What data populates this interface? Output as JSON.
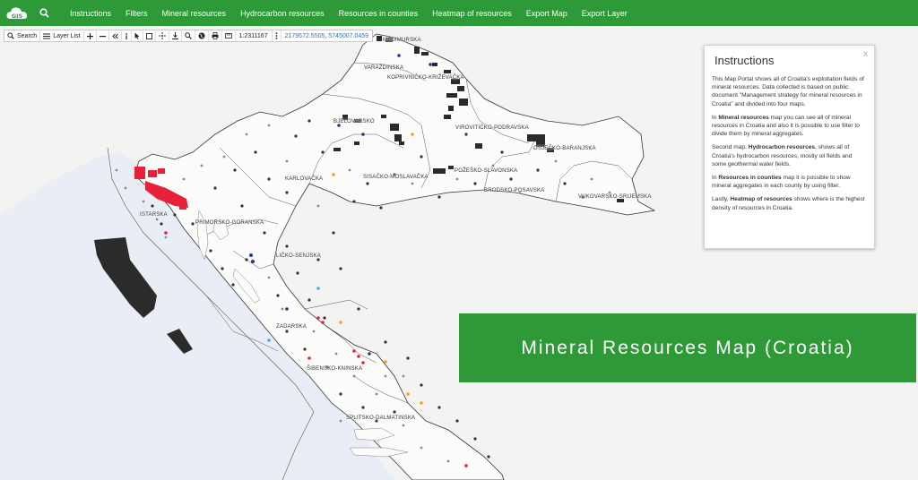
{
  "navbar": {
    "logo_text": "GIS",
    "items": [
      "Instructions",
      "Filters",
      "Mineral resources",
      "Hydrocarbon resources",
      "Resources in counties",
      "Heatmap of resources",
      "Export Map",
      "Export Layer"
    ]
  },
  "toolbar": {
    "search_label": "Search",
    "layer_list_label": "Layer List",
    "scale": "1:2311167",
    "coordinates": "2179572.5505, 5745007.0459"
  },
  "counties": {
    "medimurska": "MEĐIMURSKA",
    "varazdinska": "VARAŽDINSKA",
    "koprivnicko": "KOPRIVNIČKO-KRIŽEVAČKA",
    "bjelovarsko": "BJELOVARSKO",
    "viroviticko": "VIROVITIČKO-PODRAVSKA",
    "osjecko": "OSJEČKO-BARANJSKA",
    "pozesko": "POŽEŠKO-SLAVONSKA",
    "karlovacka": "KARLOVAČKA",
    "sisacko": "SISAČKO-MOSLAVAČKA",
    "brodsko": "BRODSKO-POSAVSKA",
    "vukovarsko": "VUKOVARSKO-SRIJEMSKA",
    "istarska": "ISTARSKA",
    "primorsko": "PRIMORSKO-GORANSKA",
    "licko": "LIČKO-SENJSKA",
    "zadarska": "ZADARSKA",
    "sibensko": "ŠIBENSKO-KNINSKA",
    "splitsko": "SPLITSKO-DALMATINSKA"
  },
  "panel": {
    "title": "Instructions",
    "close": "x",
    "p1": "This Map Portal shows all of Croatia's exploitation fields of mineral resources. Data collected is based on public document \"Management strategy for mineral resources in Croatia\" and divided into four maps.",
    "p2_pre": "In ",
    "p2_bold": "Mineral resources",
    "p2_post": " map you can see all of mineral resources in Croatia and also it is possible to use filter to divide them by mineral aggregates.",
    "p3_pre": "Second map, ",
    "p3_bold": "Hydrocarbon resources",
    "p3_post": ", shows all of Croatia's hydrocarbon resources, mostly oil fields and some geothermal water fields.",
    "p4_pre": "In ",
    "p4_bold": "Resources in counties",
    "p4_post": " map it is possible to show mineral aggregates in each county by using filter.",
    "p5_pre": "Lastly, ",
    "p5_bold": "Heatmap of resources",
    "p5_post": " shows where is the highest density of resources in Croatia."
  },
  "banner": {
    "text": "Mineral Resources Map (Croatia)"
  },
  "colors": {
    "brand_green": "#2e9a37",
    "sea": "#e8ecf4",
    "land": "#f3f3f1",
    "marker_red": "#e8213a",
    "marker_dark": "#2a2a2a"
  }
}
